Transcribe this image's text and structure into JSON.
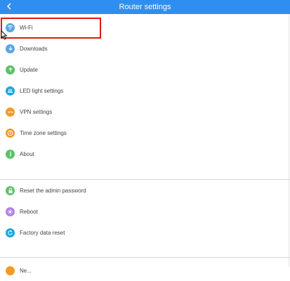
{
  "header": {
    "title": "Router settings"
  },
  "menu": [
    {
      "label": "Wi-Fi",
      "icon": "wifi-icon",
      "color": "#5aa5e6"
    },
    {
      "label": "Downloads",
      "icon": "download-icon",
      "color": "#5aa5e6"
    },
    {
      "label": "Update",
      "icon": "update-icon",
      "color": "#5fbf6b"
    },
    {
      "label": "LED light settings",
      "icon": "led-light-icon",
      "color": "#1aa7e0"
    },
    {
      "label": "VPN settings",
      "icon": "vpn-icon",
      "color": "#f39a27",
      "icon_text": "VPN"
    },
    {
      "label": "Time zone settings",
      "icon": "clock-icon",
      "color": "#f39a27"
    },
    {
      "label": "About",
      "icon": "info-icon",
      "color": "#5fbf6b"
    },
    {
      "label": "Reset the admin password",
      "icon": "lock-icon",
      "color": "#5fbf6b"
    },
    {
      "label": "Reboot",
      "icon": "reboot-icon",
      "color": "#b07ee6"
    },
    {
      "label": "Factory data reset",
      "icon": "factory-reset-icon",
      "color": "#1aa7e0"
    },
    {
      "label": "Ne...",
      "icon": "network-icon",
      "color": "#f39a27"
    }
  ],
  "colors": {
    "header": "#2f8ff0",
    "highlight": "#e01818"
  }
}
